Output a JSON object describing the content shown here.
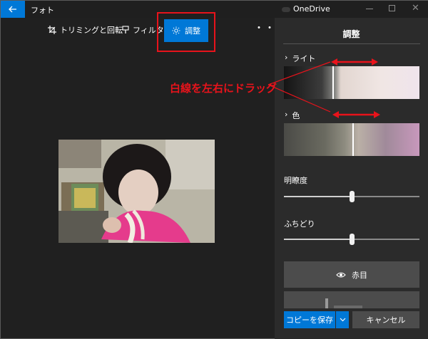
{
  "titlebar": {
    "app_title": "フォト",
    "onedrive_label": "OneDrive",
    "icons": [
      "back-arrow-icon",
      "onedrive-icon",
      "minimize-icon",
      "maximize-icon",
      "close-icon"
    ]
  },
  "toolbar": {
    "crop_label": "トリミングと回転",
    "filter_label": "フィルター",
    "adjust_label": "調整",
    "more_label": "・・・"
  },
  "panel": {
    "title": "調整",
    "light_label": "ライト",
    "color_label": "色",
    "chevron": "›",
    "clarity_label": "明瞭度",
    "clarity_value": 0.5,
    "vignette_label": "ふちどり",
    "vignette_value": 0.5,
    "redeye_label": "赤目",
    "save_label": "コピーを保存",
    "cancel_label": "キャンセル"
  },
  "annotation": {
    "text": "白線を左右にドラッグ",
    "color": "#e8131b"
  },
  "colors": {
    "accent": "#0078d7",
    "panel_bg": "#2b2b2b",
    "app_bg": "#202020"
  }
}
